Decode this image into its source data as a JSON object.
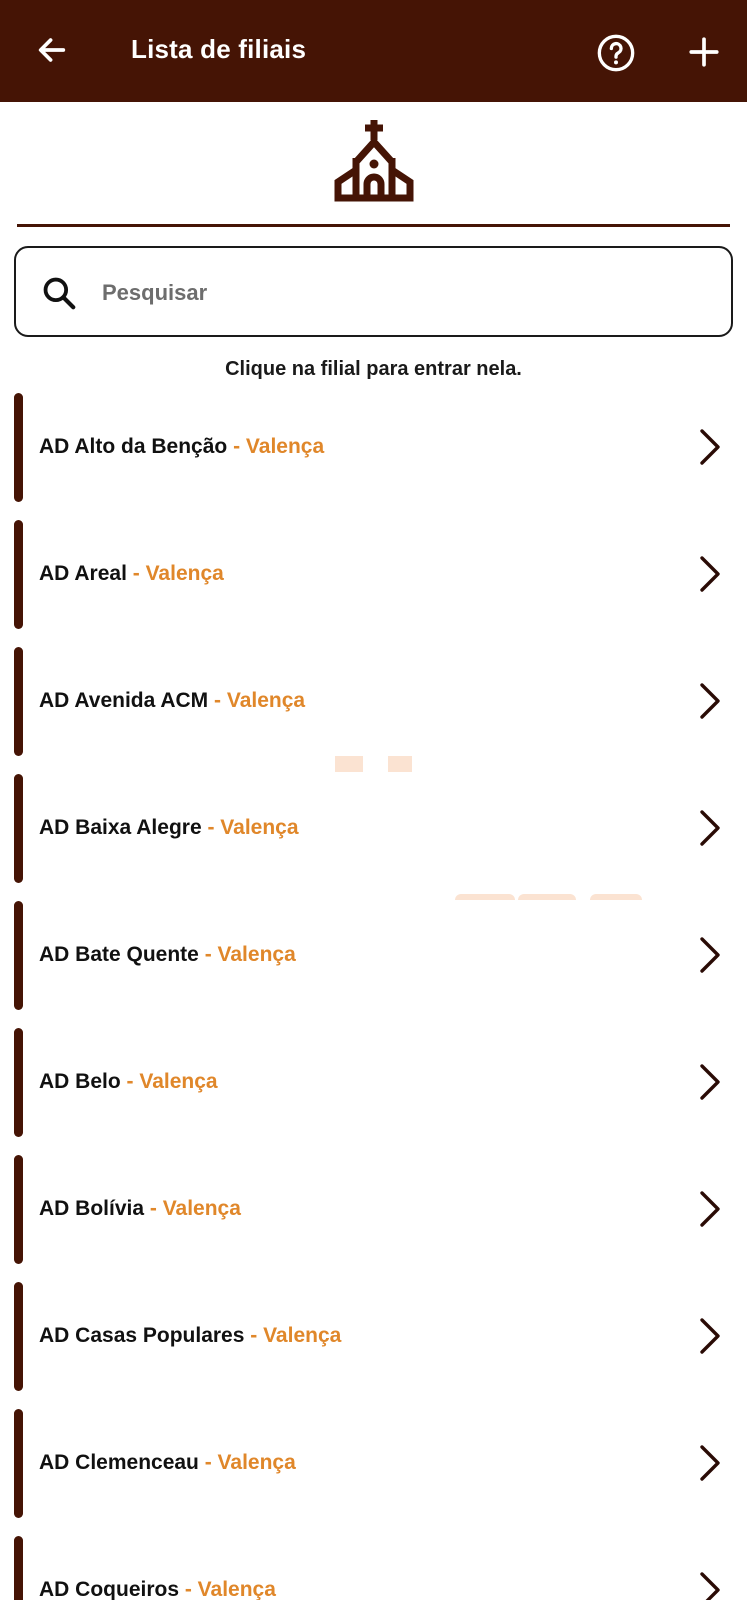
{
  "header": {
    "title": "Lista de filiais",
    "back_icon": "arrow-left-icon",
    "help_icon": "help-circle-icon",
    "add_icon": "plus-icon"
  },
  "hero": {
    "icon": "church-icon"
  },
  "search": {
    "placeholder": "Pesquisar",
    "value": "",
    "icon": "search-icon"
  },
  "hint": "Clique na filial para entrar nela.",
  "branches": [
    {
      "name": "AD Alto da Benção",
      "city": " - Valença"
    },
    {
      "name": "AD Areal",
      "city": " - Valença"
    },
    {
      "name": "AD Avenida ACM",
      "city": " - Valença"
    },
    {
      "name": "AD Baixa Alegre",
      "city": " - Valença"
    },
    {
      "name": "AD Bate Quente",
      "city": " - Valença"
    },
    {
      "name": "AD Belo",
      "city": " - Valença"
    },
    {
      "name": "AD Bolívia",
      "city": " - Valença"
    },
    {
      "name": "AD Casas Populares",
      "city": " - Valença"
    },
    {
      "name": "AD Clemenceau",
      "city": " - Valença"
    },
    {
      "name": "AD Coqueiros",
      "city": " - Valença"
    }
  ],
  "colors": {
    "primary": "#451405",
    "accent": "#e0872a",
    "text": "#111111"
  }
}
